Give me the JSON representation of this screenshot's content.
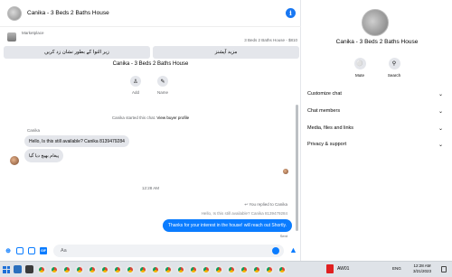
{
  "chat": {
    "title": "Canika - 3 Beds 2 Baths House",
    "marketplace_label": "Marketplace",
    "listing_line": "3 Beds 2 Baths House - $810",
    "button_more_options": "مزید آپشنز",
    "button_mark_pending": "زیر التوا کے بطور نشان زد کریں",
    "conversation_title": "Canika - 3 Beds 2 Baths House",
    "add_label": "Add",
    "name_label": "Name",
    "system_text": "Canika started this chat.",
    "view_profile": "View buyer profile",
    "sender": "Canika",
    "msg1": "Hello, Is this still available? Canika 8139479284",
    "msg2": "پیغام بھیج دیا گیا",
    "timestamp": "12:28 AM",
    "reply_note": "You replied to Canika",
    "quoted_text": "Hello, Is this still available? Canika 8139479284",
    "reply_text": "Thanks for your interest in the house! will reach out Shortly.",
    "sent_status": "Sent",
    "composer_placeholder": "Aa"
  },
  "side": {
    "title": "Canika - 3 Beds 2 Baths House",
    "mute_label": "Mute",
    "search_label": "Search",
    "rows": [
      {
        "label": "Customize chat"
      },
      {
        "label": "Chat members"
      },
      {
        "label": "Media, files and links"
      },
      {
        "label": "Privacy & support"
      }
    ]
  },
  "taskbar": {
    "app_label": "AW01",
    "lang": "ENG",
    "time": "12:28 AM",
    "date": "3/21/2023"
  },
  "colors": {
    "accent": "#0a7cff",
    "brand": "#1877f2",
    "bubble_in": "#e4e6eb"
  },
  "icons": [
    "info-icon",
    "person-add-icon",
    "pencil-icon",
    "bell-icon",
    "search-icon",
    "chevron-down-icon",
    "plus-circle-icon",
    "image-icon",
    "sticker-icon",
    "gif-icon",
    "emoji-icon",
    "like-icon"
  ]
}
